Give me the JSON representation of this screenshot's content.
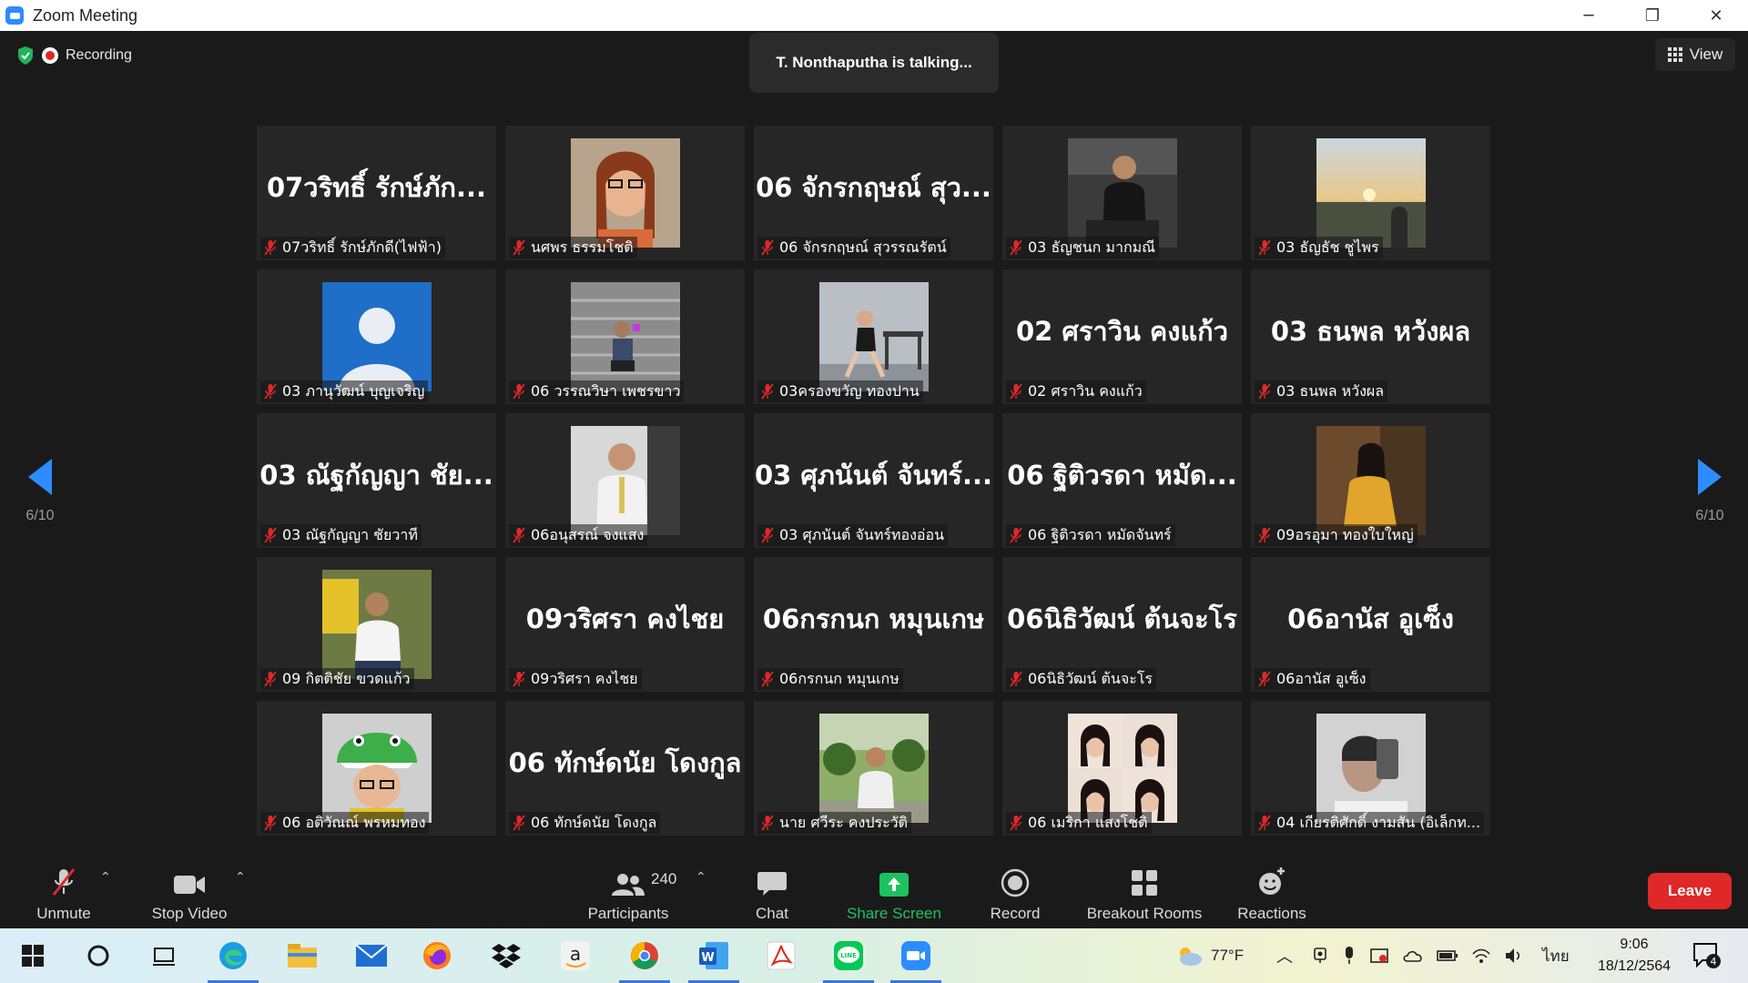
{
  "window": {
    "title": "Zoom Meeting",
    "controls": {
      "minimize": "─",
      "restore": "❐",
      "close": "✕"
    }
  },
  "meeting": {
    "recording_label": "Recording",
    "talking_banner": "T. Nonthaputha is talking...",
    "view_label": "View",
    "page_indicator_left": "6/10",
    "page_indicator_right": "6/10"
  },
  "participants": [
    {
      "big_name": "07วริทธิ์ รักษ์ภัก...",
      "name": "07วริทธิ์ รักษ์ภักดี(ไฟฟ้า)",
      "video": false,
      "photo": ""
    },
    {
      "big_name": "",
      "name": "นศพร ธรรมโชติ",
      "video": true,
      "photo": "woman-glasses"
    },
    {
      "big_name": "06 จักรกฤษณ์ สุว...",
      "name": "06 จักรกฤษณ์ สุวรรณรัตน์",
      "video": false,
      "photo": ""
    },
    {
      "big_name": "",
      "name": "03 ธัญชนก มากมณี",
      "video": true,
      "photo": "man-night"
    },
    {
      "big_name": "",
      "name": "03 ธัญธัช ชูไพร",
      "video": true,
      "photo": "sunset"
    },
    {
      "big_name": "",
      "name": "03 ภานุวัฒน์ บุญเจริญ",
      "video": true,
      "photo": "default-avatar"
    },
    {
      "big_name": "",
      "name": "06 วรรณวิษา เพชรขาว",
      "video": true,
      "photo": "stairs"
    },
    {
      "big_name": "",
      "name": "03ครองขวัญ ทองปาน",
      "video": true,
      "photo": "girl-bench"
    },
    {
      "big_name": "02 ศราวิน คงแก้ว",
      "name": "02 ศราวิน คงแก้ว",
      "video": false,
      "photo": ""
    },
    {
      "big_name": "03 ธนพล หวังผล",
      "name": "03 ธนพล หวังผล",
      "video": false,
      "photo": ""
    },
    {
      "big_name": "03 ณัฐกัญญา ชัย...",
      "name": "03 ณัฐกัญญา ชัยวาที",
      "video": false,
      "photo": ""
    },
    {
      "big_name": "",
      "name": "06อนุสรณ์ จงแสง",
      "video": true,
      "photo": "man-shirt"
    },
    {
      "big_name": "03 ศุภนันต์ จันทร์...",
      "name": "03 ศุภนันต์ จันทร์ทองอ่อน",
      "video": false,
      "photo": ""
    },
    {
      "big_name": "06 ฐิติวรดา หมัด...",
      "name": "06 ฐิติวรดา หมัดจันทร์",
      "video": false,
      "photo": ""
    },
    {
      "big_name": "",
      "name": "09อรอุมา ทองใบใหญ่",
      "video": true,
      "photo": "woman-yellow"
    },
    {
      "big_name": "",
      "name": "09 กิตติชัย ขวดแก้ว",
      "video": true,
      "photo": "boy-yellow"
    },
    {
      "big_name": "09วริศรา คงไชย",
      "name": "09วริศรา คงไชย",
      "video": false,
      "photo": ""
    },
    {
      "big_name": "06กรกนก หมุนเกษ",
      "name": "06กรกนก หมุนเกษ",
      "video": false,
      "photo": ""
    },
    {
      "big_name": "06นิธิวัฒน์ ต้นจะโร",
      "name": "06นิธิวัฒน์ ต้นจะโร",
      "video": false,
      "photo": ""
    },
    {
      "big_name": "06อานัส อูเซ็ง",
      "name": "06อานัส อูเซ็ง",
      "video": false,
      "photo": ""
    },
    {
      "big_name": "",
      "name": "06 อติวัณณ์ พรหมทอง",
      "video": true,
      "photo": "dino-hat"
    },
    {
      "big_name": "06 ทักษ์ดนัย โดงกูล",
      "name": "06 ทักษ์ดนัย โดงกูล",
      "video": false,
      "photo": ""
    },
    {
      "big_name": "",
      "name": "นาย ศวีระ คงประวัติ",
      "video": true,
      "photo": "man-garden"
    },
    {
      "big_name": "",
      "name": "06 เมริกา แสงโชติ",
      "video": true,
      "photo": "collage"
    },
    {
      "big_name": "",
      "name": "04 เกียรติศักดิ์ งามสัน (อิเล็กท...",
      "video": true,
      "photo": "selfie"
    }
  ],
  "toolbar": {
    "unmute": "Unmute",
    "stop_video": "Stop Video",
    "participants": "Participants",
    "participant_count": "240",
    "chat": "Chat",
    "share_screen": "Share Screen",
    "record": "Record",
    "breakout_rooms": "Breakout Rooms",
    "reactions": "Reactions",
    "leave": "Leave"
  },
  "taskbar": {
    "weather": "77°F",
    "language": "ไทย",
    "time": "9:06",
    "date": "18/12/2564",
    "notification_count": "4"
  },
  "colors": {
    "accent": "#2d8cff",
    "share_green": "#1ec15f",
    "leave_red": "#e02828",
    "mute_red": "#e02828"
  }
}
